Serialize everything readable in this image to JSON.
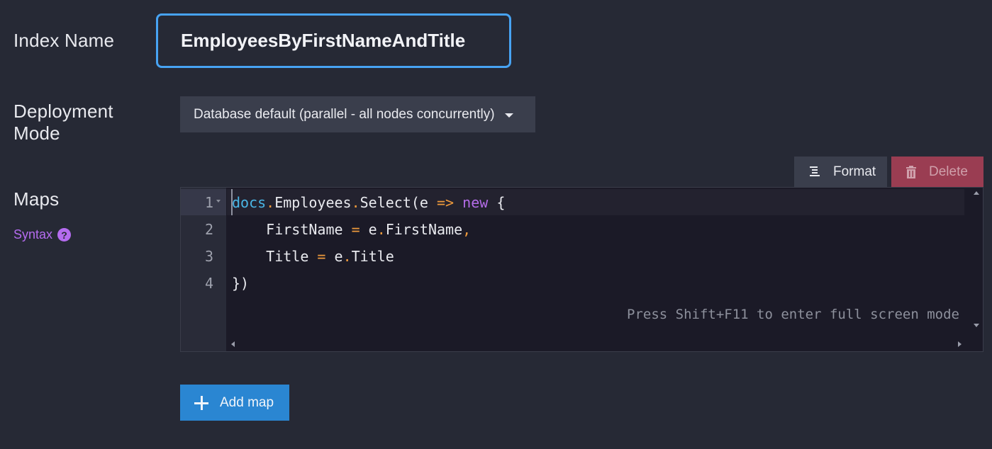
{
  "index_name": {
    "label": "Index Name",
    "value": "EmployeesByFirstNameAndTitle"
  },
  "deployment": {
    "label_line1": "Deployment",
    "label_line2": "Mode",
    "selected": "Database default (parallel - all nodes concurrently)"
  },
  "toolbar": {
    "format_label": "Format",
    "delete_label": "Delete"
  },
  "maps": {
    "label": "Maps",
    "syntax_label": "Syntax",
    "help_glyph": "?"
  },
  "editor": {
    "line_numbers": [
      "1",
      "2",
      "3",
      "4"
    ],
    "lines": [
      {
        "tokens": [
          {
            "text": "docs",
            "kind": "kw"
          },
          {
            "text": ".",
            "kind": "op"
          },
          {
            "text": "Employees",
            "kind": "txt"
          },
          {
            "text": ".",
            "kind": "op"
          },
          {
            "text": "Select(e ",
            "kind": "txt"
          },
          {
            "text": "=>",
            "kind": "op"
          },
          {
            "text": " ",
            "kind": "txt"
          },
          {
            "text": "new",
            "kind": "new"
          },
          {
            "text": " {",
            "kind": "txt"
          }
        ]
      },
      {
        "tokens": [
          {
            "text": "    FirstName ",
            "kind": "txt"
          },
          {
            "text": "=",
            "kind": "op"
          },
          {
            "text": " e",
            "kind": "txt"
          },
          {
            "text": ".",
            "kind": "op"
          },
          {
            "text": "FirstName",
            "kind": "txt"
          },
          {
            "text": ",",
            "kind": "op"
          }
        ]
      },
      {
        "tokens": [
          {
            "text": "    Title ",
            "kind": "txt"
          },
          {
            "text": "=",
            "kind": "op"
          },
          {
            "text": " e",
            "kind": "txt"
          },
          {
            "text": ".",
            "kind": "op"
          },
          {
            "text": "Title",
            "kind": "txt"
          }
        ]
      },
      {
        "tokens": [
          {
            "text": "})",
            "kind": "txt"
          }
        ]
      }
    ],
    "hint": "Press Shift+F11 to enter full screen mode"
  },
  "add_map": {
    "label": "Add map"
  },
  "colors": {
    "background": "#262935",
    "accent_input_border": "#47a3f3",
    "delete_button": "#9a3d52",
    "add_button": "#2a86d2",
    "syntax_link": "#b56cf0"
  },
  "icons": {
    "format": "format-align-icon",
    "delete": "trash-icon",
    "add": "plus-icon",
    "help": "question-circle-icon",
    "dropdown": "caret-down-icon"
  }
}
